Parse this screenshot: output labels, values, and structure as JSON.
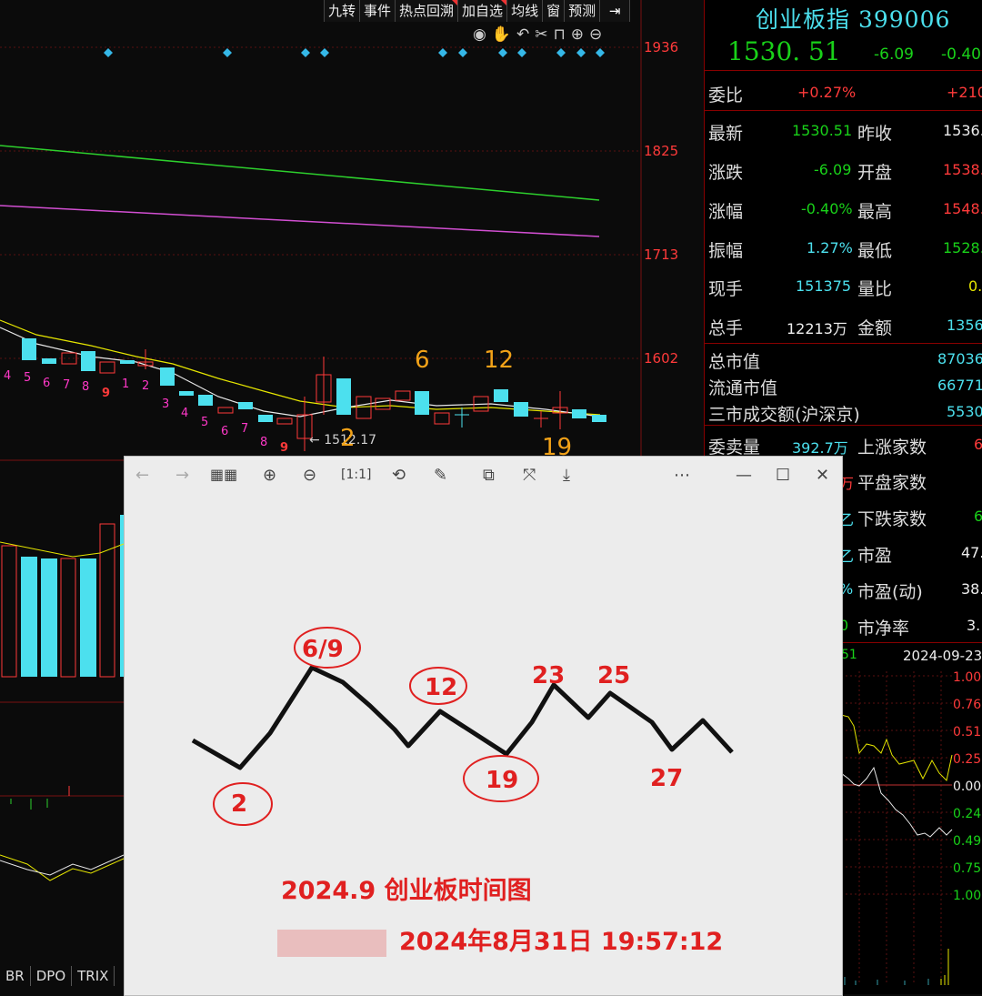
{
  "toolbar": {
    "items": [
      "九转",
      "事件",
      "热点回溯",
      "加自选",
      "均线",
      "窗",
      "预测"
    ],
    "exit_icon": "exit-icon"
  },
  "chart_tools": {
    "icons": [
      "eye-icon",
      "hand-icon",
      "undo-icon",
      "cut-icon",
      "lock-icon",
      "zoom-in-icon",
      "zoom-out-icon"
    ]
  },
  "main_chart": {
    "price_axis": [
      "1936",
      "1825",
      "1713",
      "1602"
    ],
    "low_marker": "1512.17",
    "countdown_labels": [
      "4",
      "5",
      "6",
      "7",
      "8",
      "9",
      "1",
      "2",
      "3",
      "4",
      "5",
      "6",
      "7",
      "8",
      "9"
    ],
    "date_labels": [
      "6",
      "12",
      "2",
      "19"
    ]
  },
  "index": {
    "title": "创业板指 399006",
    "price": "1530. 51",
    "change": "-6.09",
    "change_pct": "-0.40"
  },
  "quote_rows": [
    {
      "label": "委比",
      "value": "+0.27%",
      "label2": "",
      "value2": "+210"
    },
    {
      "label": "最新",
      "value": "1530.51",
      "label2": "昨收",
      "value2": "1536."
    },
    {
      "label": "涨跌",
      "value": "-6.09",
      "label2": "开盘",
      "value2": "1538."
    },
    {
      "label": "涨幅",
      "value": "-0.40%",
      "label2": "最高",
      "value2": "1548."
    },
    {
      "label": "振幅",
      "value": "1.27%",
      "label2": "最低",
      "value2": "1528."
    },
    {
      "label": "现手",
      "value": "151375",
      "label2": "量比",
      "value2": "0."
    },
    {
      "label": "总手",
      "value": "12213万",
      "label2": "金额",
      "value2": "1356"
    }
  ],
  "market_rows": [
    {
      "label": "总市值",
      "value": "87036"
    },
    {
      "label": "流通市值",
      "value": "66771"
    },
    {
      "label": "三市成交额(沪深京)",
      "value": "5530"
    }
  ],
  "stat_rows": [
    {
      "label": "委卖量",
      "value": "392.7万",
      "label2": "上涨家数",
      "value2": "6"
    },
    {
      "label": "",
      "value": "万",
      "label2": "平盘家数",
      "value2": ""
    },
    {
      "label": "",
      "value": "乙",
      "label2": "下跌家数",
      "value2": "6"
    },
    {
      "label": "",
      "value": "乙",
      "label2": "市盈",
      "value2": "47."
    },
    {
      "label": "",
      "value": "%",
      "label2": "市盈(动)",
      "value2": "38."
    },
    {
      "label": "",
      "value": "0",
      "label2": "市净率",
      "value2": "3."
    }
  ],
  "mini_chart": {
    "left_label": "51",
    "date": "2024-09-23",
    "right_axis": [
      "1.00",
      "0.76",
      "0.51",
      "0.25",
      "0.00",
      "0.24",
      "0.49",
      "0.75",
      "1.00"
    ]
  },
  "viewer": {
    "toolbar_icons": [
      "back-icon",
      "forward-icon",
      "gallery-icon",
      "zoom-in-icon",
      "zoom-out-icon",
      "actual-size-icon",
      "rotate-icon",
      "edit-icon",
      "crop-icon",
      "fit-icon",
      "save-icon",
      "more-icon",
      "minimize-icon",
      "maximize-icon",
      "close-icon"
    ],
    "image": {
      "labels": [
        "6/9",
        "12",
        "23",
        "25",
        "2",
        "19",
        "27"
      ],
      "title": "2024.9 创业板时间图",
      "author_time": "2024年8月31日 19:57:12"
    }
  },
  "bottom_tabs": [
    "BR",
    "DPO",
    "TRIX"
  ]
}
